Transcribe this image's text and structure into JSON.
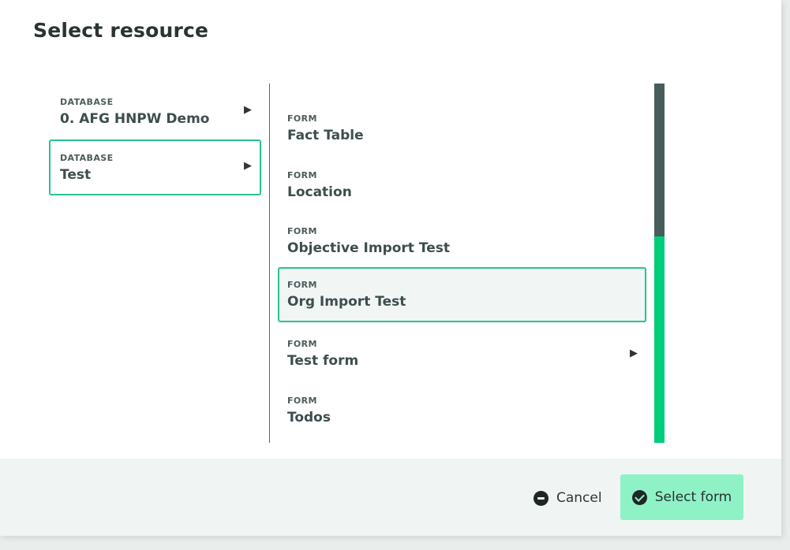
{
  "dialog": {
    "title": "Select resource"
  },
  "databases": [
    {
      "type": "DATABASE",
      "label": "0. AFG HNPW Demo",
      "expandable": true,
      "selected": false
    },
    {
      "type": "DATABASE",
      "label": "Test",
      "expandable": true,
      "selected": true
    }
  ],
  "forms": [
    {
      "type": "FORM",
      "label": "Fact Table",
      "expandable": false,
      "selected": false
    },
    {
      "type": "FORM",
      "label": "Location",
      "expandable": false,
      "selected": false
    },
    {
      "type": "FORM",
      "label": "Objective Import Test",
      "expandable": false,
      "selected": false
    },
    {
      "type": "FORM",
      "label": "Org Import Test",
      "expandable": false,
      "selected": true
    },
    {
      "type": "FORM",
      "label": "Test form",
      "expandable": true,
      "selected": false
    },
    {
      "type": "FORM",
      "label": "Todos",
      "expandable": false,
      "selected": false
    }
  ],
  "icons": {
    "expand": "play-arrow-icon",
    "cancel": "minus-circle-icon",
    "confirm": "check-circle-icon"
  },
  "colors": {
    "accent": "#27c48a",
    "primary_button": "#8ff2c7",
    "scroll_track": "#00cc7a",
    "scroll_thumb": "#475d5c"
  },
  "footer": {
    "cancel_label": "Cancel",
    "select_label": "Select form"
  }
}
